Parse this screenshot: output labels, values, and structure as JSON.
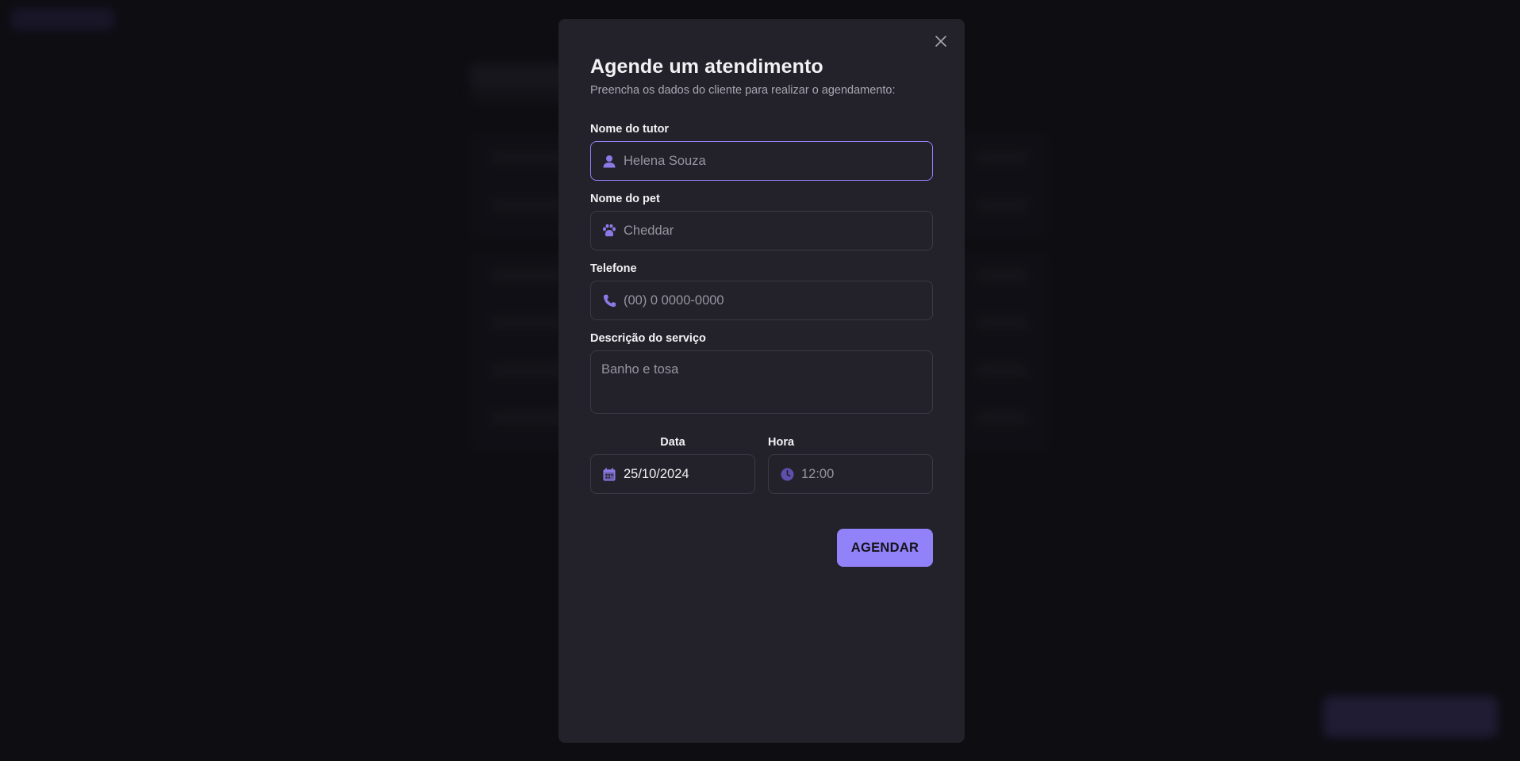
{
  "modal": {
    "title": "Agende um atendimento",
    "subtitle": "Preencha os dados do cliente para realizar o agendamento:",
    "fields": {
      "tutor": {
        "label": "Nome do tutor",
        "placeholder": "Helena Souza",
        "icon": "user-icon"
      },
      "pet": {
        "label": "Nome do pet",
        "placeholder": "Cheddar",
        "icon": "paw-icon"
      },
      "phone": {
        "label": "Telefone",
        "placeholder": "(00) 0 0000-0000",
        "icon": "phone-icon"
      },
      "service": {
        "label": "Descrição do serviço",
        "placeholder": "Banho e tosa"
      },
      "date": {
        "label": "Data",
        "value": "25/10/2024",
        "icon": "calendar-icon"
      },
      "time": {
        "label": "Hora",
        "placeholder": "12:00",
        "icon": "clock-icon"
      }
    },
    "submit_label": "AGENDAR",
    "close_icon": "close-icon"
  },
  "colors": {
    "accent": "#9282fa",
    "background": "#131217",
    "modal_bg": "#23222a",
    "border": "#3b3a44"
  }
}
